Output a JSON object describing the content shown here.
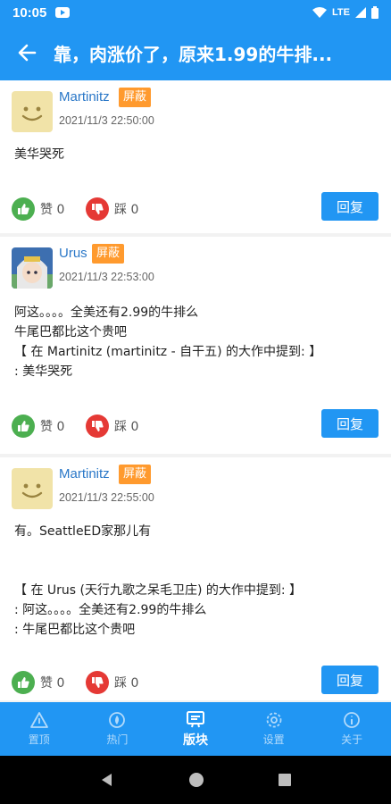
{
  "status_bar": {
    "time": "10:05",
    "network": "LTE"
  },
  "app_bar": {
    "title": "靠，肉涨价了，原来1.99的牛排..."
  },
  "posts": [
    {
      "username": "Martinitz",
      "badge": "屏蔽",
      "timestamp": "2021/11/3 22:50:00",
      "body": "美华哭死",
      "like_label": "赞 0",
      "dislike_label": "踩 0",
      "reply_label": "回复"
    },
    {
      "username": "Urus",
      "badge": "屏蔽",
      "timestamp": "2021/11/3 22:53:00",
      "body": "阿这。。。。全美还有2.99的牛排么\n牛尾巴都比这个贵吧\n【 在 Martinitz (martinitz - 自干五) 的大作中提到: 】\n: 美华哭死",
      "like_label": "赞 0",
      "dislike_label": "踩 0",
      "reply_label": "回复"
    },
    {
      "username": "Martinitz",
      "badge": "屏蔽",
      "timestamp": "2021/11/3 22:55:00",
      "body": "有。SeattleED家那儿有\n\n\n【 在 Urus (天行九歌之呆毛卫庄) 的大作中提到: 】\n: 阿这。。。。全美还有2.99的牛排么\n: 牛尾巴都比这个贵吧",
      "like_label": "赞 0",
      "dislike_label": "踩 0",
      "reply_label": "回复"
    }
  ],
  "bottom_nav": [
    {
      "label": "置顶",
      "icon": "pin-icon"
    },
    {
      "label": "热门",
      "icon": "fire-icon"
    },
    {
      "label": "版块",
      "icon": "board-icon",
      "active": true
    },
    {
      "label": "设置",
      "icon": "gear-icon"
    },
    {
      "label": "关于",
      "icon": "info-icon"
    }
  ],
  "colors": {
    "primary": "#2196f3",
    "badge": "#ff9a2e",
    "like": "#4caf50",
    "dislike": "#e53935",
    "username": "#2b78c8"
  }
}
